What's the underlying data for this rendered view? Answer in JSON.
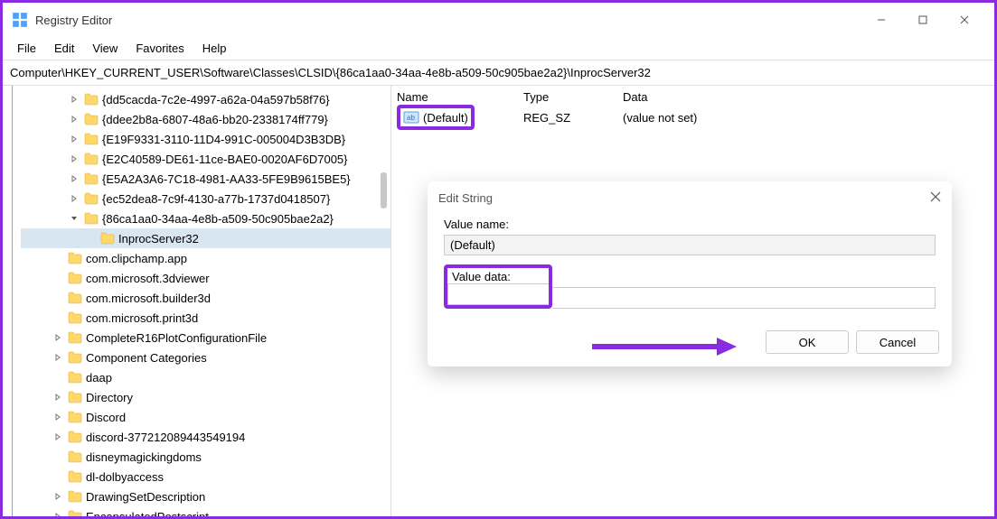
{
  "titlebar": {
    "title": "Registry Editor"
  },
  "menubar": [
    "File",
    "Edit",
    "View",
    "Favorites",
    "Help"
  ],
  "address": "Computer\\HKEY_CURRENT_USER\\Software\\Classes\\CLSID\\{86ca1aa0-34aa-4e8b-a509-50c905bae2a2}\\InprocServer32",
  "tree": {
    "items": [
      {
        "level": 2,
        "exp": ">",
        "label": "{dd5cacda-7c2e-4997-a62a-04a597b58f76}"
      },
      {
        "level": 2,
        "exp": ">",
        "label": "{ddee2b8a-6807-48a6-bb20-2338174ff779}"
      },
      {
        "level": 2,
        "exp": ">",
        "label": "{E19F9331-3110-11D4-991C-005004D3B3DB}"
      },
      {
        "level": 2,
        "exp": ">",
        "label": "{E2C40589-DE61-11ce-BAE0-0020AF6D7005}"
      },
      {
        "level": 2,
        "exp": ">",
        "label": "{E5A2A3A6-7C18-4981-AA33-5FE9B9615BE5}"
      },
      {
        "level": 2,
        "exp": ">",
        "label": "{ec52dea8-7c9f-4130-a77b-1737d0418507}"
      },
      {
        "level": 2,
        "exp": "v",
        "label": "{86ca1aa0-34aa-4e8b-a509-50c905bae2a2}"
      },
      {
        "level": 3,
        "exp": "",
        "label": "InprocServer32",
        "selected": true
      },
      {
        "level": 1,
        "exp": "",
        "label": "com.clipchamp.app"
      },
      {
        "level": 1,
        "exp": "",
        "label": "com.microsoft.3dviewer"
      },
      {
        "level": 1,
        "exp": "",
        "label": "com.microsoft.builder3d"
      },
      {
        "level": 1,
        "exp": "",
        "label": "com.microsoft.print3d"
      },
      {
        "level": 1,
        "exp": ">",
        "label": "CompleteR16PlotConfigurationFile"
      },
      {
        "level": 1,
        "exp": ">",
        "label": "Component Categories"
      },
      {
        "level": 1,
        "exp": "",
        "label": "daap"
      },
      {
        "level": 1,
        "exp": ">",
        "label": "Directory"
      },
      {
        "level": 1,
        "exp": ">",
        "label": "Discord"
      },
      {
        "level": 1,
        "exp": ">",
        "label": "discord-377212089443549194"
      },
      {
        "level": 1,
        "exp": "",
        "label": "disneymagickingdoms"
      },
      {
        "level": 1,
        "exp": "",
        "label": "dl-dolbyaccess"
      },
      {
        "level": 1,
        "exp": ">",
        "label": "DrawingSetDescription"
      },
      {
        "level": 1,
        "exp": ">",
        "label": "EncapsulatedPostscript"
      }
    ]
  },
  "list": {
    "columns": {
      "name": "Name",
      "type": "Type",
      "data": "Data"
    },
    "rows": [
      {
        "name": "(Default)",
        "type": "REG_SZ",
        "data": "(value not set)"
      }
    ]
  },
  "dialog": {
    "title": "Edit String",
    "valueNameLabel": "Value name:",
    "valueName": "(Default)",
    "valueDataLabel": "Value data:",
    "valueData": "",
    "ok": "OK",
    "cancel": "Cancel"
  }
}
